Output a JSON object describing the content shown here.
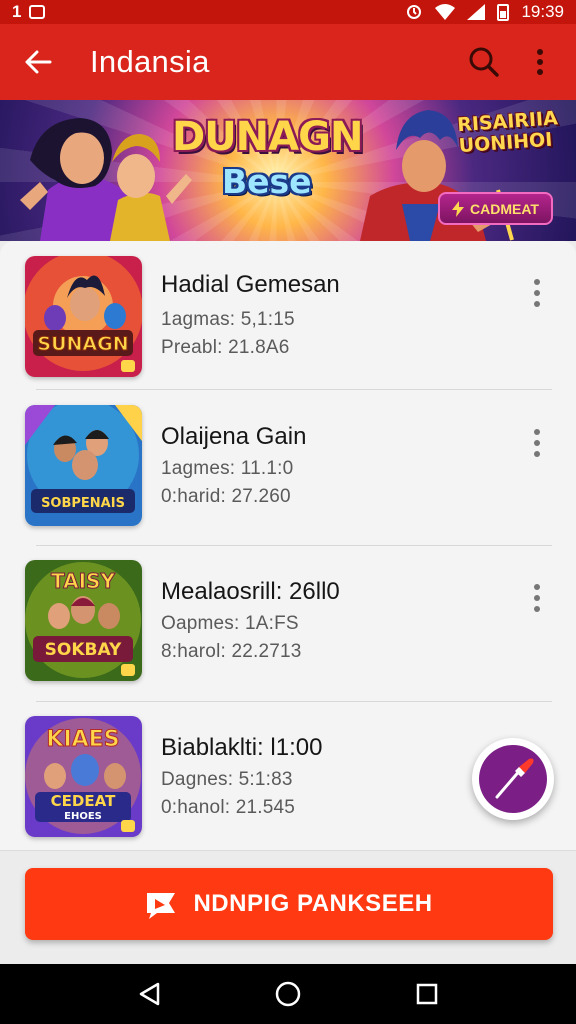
{
  "status_bar": {
    "left_text": "1",
    "time": "19:39"
  },
  "app_bar": {
    "title": "Indansia",
    "back_icon": "arrow-left-icon",
    "search_icon": "search-icon",
    "menu_icon": "more-vert-icon"
  },
  "banner": {
    "title": "DUNAGN",
    "subtitle": "Bese",
    "side_text_1": "RISAIRIIA",
    "side_text_2": "UONIHOI",
    "cta_label": "CADMEAT"
  },
  "items": [
    {
      "title": "Hadial Gemesan",
      "line1": "1agmas: 5,1:15",
      "line2": "Preabl: 21.8A6",
      "thumb_text": "SUNAGN"
    },
    {
      "title": "Olaijena Gain",
      "line1": "1agmes: 11.1:0",
      "line2": "0:harid: 27.260",
      "thumb_text": "SOBPENAIS"
    },
    {
      "title": "Mealaosrill: 26ll0",
      "line1": "Oapmes: 1A:FS",
      "line2": "8:harol: 22.2713",
      "thumb_text": "SOKBAY"
    },
    {
      "title": "Biablaklti: l1:00",
      "line1": "Dagnes: 5:1:83",
      "line2": "0:hanol: 21.545",
      "thumb_text": "CEDEAT"
    }
  ],
  "fab": {
    "icon": "brush-icon"
  },
  "main_button": {
    "label": "NDNPIG PANKSEEH",
    "icon": "flag-icon"
  },
  "colors": {
    "primary": "#d9251b",
    "status": "#c4150c",
    "button": "#ff3a12",
    "fab": "#7b1f86"
  }
}
